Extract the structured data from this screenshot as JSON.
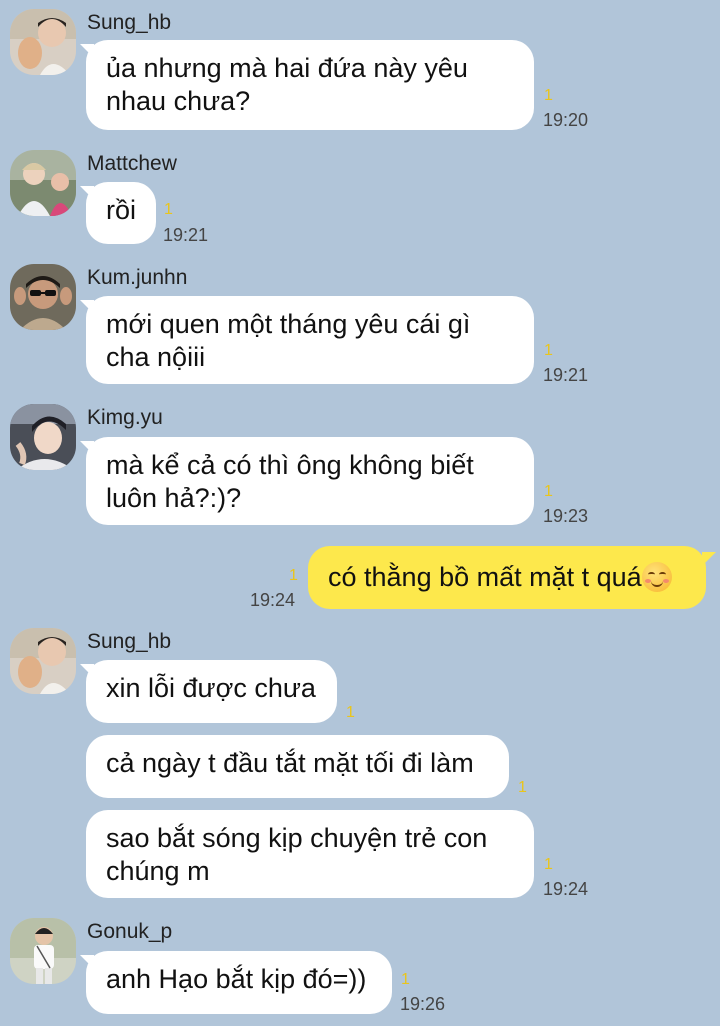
{
  "messages": [
    {
      "sender": "Sung_hb",
      "avatar": "avatar-sung-hb",
      "lines": [
        "ủa nhưng mà hai đứa này yêu",
        "nhau chưa?"
      ],
      "unread": "1",
      "time": "19:20"
    },
    {
      "sender": "Mattchew",
      "avatar": "avatar-mattchew",
      "lines": [
        "rồi"
      ],
      "unread": "1",
      "time": "19:21"
    },
    {
      "sender": "Kum.junhn",
      "avatar": "avatar-kum-junhn",
      "lines": [
        "mới quen một tháng yêu cái gì",
        "cha nộiii"
      ],
      "unread": "1",
      "time": "19:21"
    },
    {
      "sender": "Kimg.yu",
      "avatar": "avatar-kimg-yu",
      "lines": [
        "mà kể cả có thì ông không biết",
        "luôn hả?:)?"
      ],
      "unread": "1",
      "time": "19:23"
    },
    {
      "sender": "",
      "mine": true,
      "lines": [
        "có thằng bồ mất mặt t quá"
      ],
      "emoji": "smiling-blush-emoji",
      "unread": "1",
      "time": "19:24"
    },
    {
      "sender": "Sung_hb",
      "avatar": "avatar-sung-hb",
      "lines": [
        "xin lỗi được chưa"
      ],
      "unread": "1",
      "time": ""
    },
    {
      "sender": "",
      "lines": [
        "cả ngày t đầu tắt mặt tối đi làm"
      ],
      "unread": "1",
      "time": ""
    },
    {
      "sender": "",
      "lines": [
        "sao bắt sóng kịp chuyện trẻ con",
        "chúng m"
      ],
      "unread": "1",
      "time": "19:24"
    },
    {
      "sender": "Gonuk_p",
      "avatar": "avatar-gonuk-p",
      "lines": [
        "anh Hạo bắt kịp đó=))"
      ],
      "unread": "1",
      "time": "19:26"
    }
  ],
  "colors": {
    "background": "#b1c5d9",
    "incoming_bubble": "#ffffff",
    "outgoing_bubble": "#fde84c",
    "unread_count": "#e9c51c"
  }
}
